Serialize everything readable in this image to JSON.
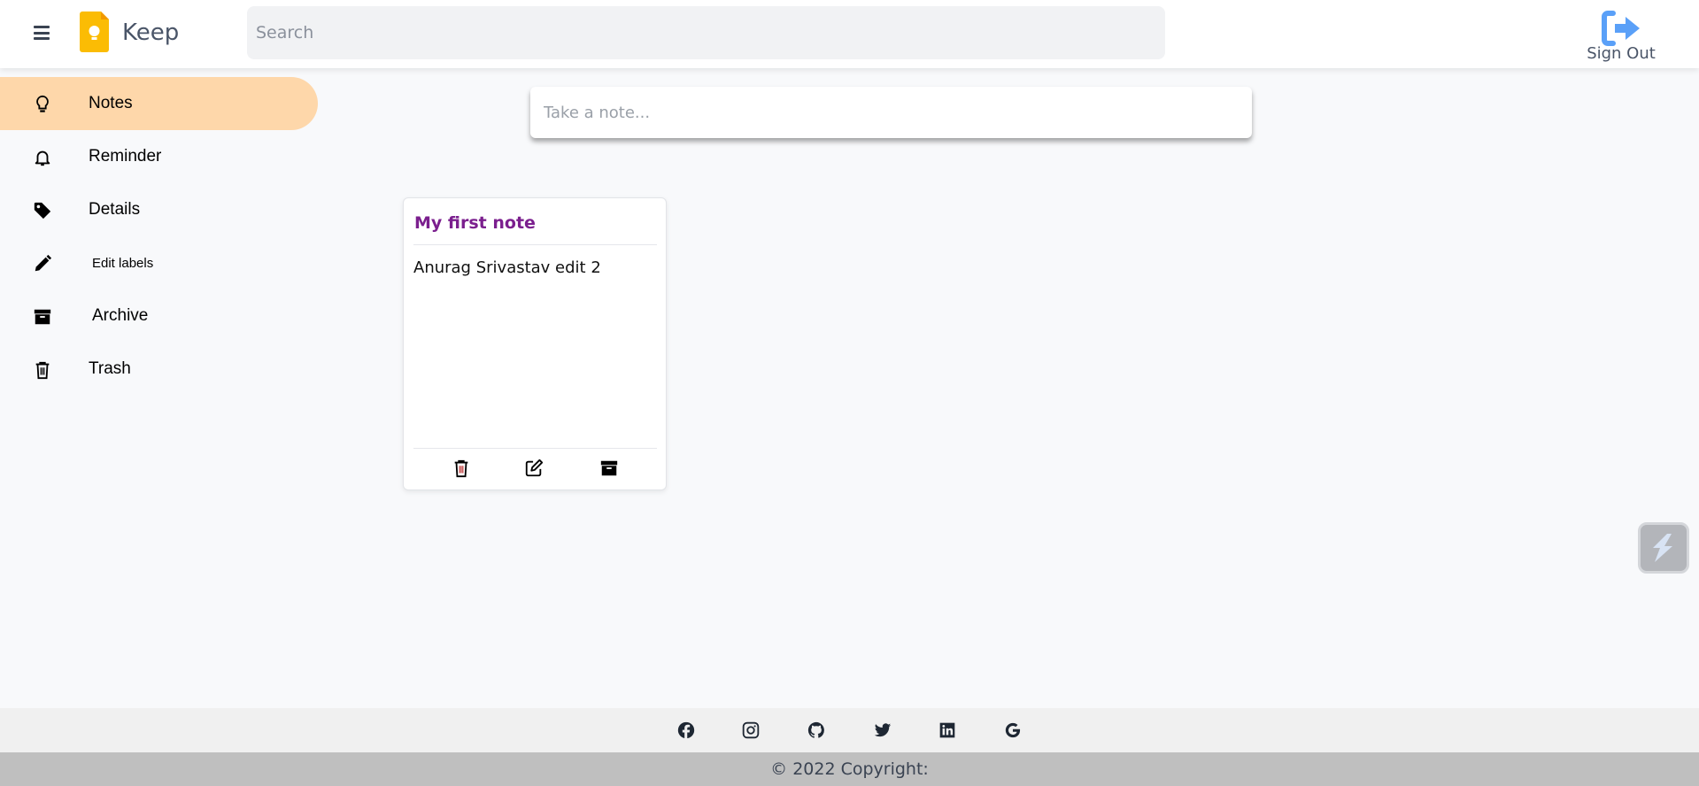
{
  "header": {
    "brand": "Keep",
    "search_placeholder": "Search",
    "sign_out": "Sign Out"
  },
  "sidebar": {
    "items": [
      {
        "label": "Notes",
        "icon": "lightbulb-icon",
        "active": true
      },
      {
        "label": "Reminder",
        "icon": "bell-icon"
      },
      {
        "label": "Details",
        "icon": "tag-icon"
      },
      {
        "label": "Edit labels",
        "icon": "pencil-icon"
      },
      {
        "label": "Archive",
        "icon": "archive-icon"
      },
      {
        "label": "Trash",
        "icon": "trash-icon"
      }
    ]
  },
  "main": {
    "take_note_placeholder": "Take a note...",
    "notes": [
      {
        "title": "My first note",
        "body": "Anurag Srivastav edit 2"
      }
    ]
  },
  "footer": {
    "social": [
      "facebook-icon",
      "instagram-icon",
      "github-icon",
      "twitter-icon",
      "linkedin-icon",
      "google-icon"
    ],
    "copyright": "© 2022 Copyright:"
  },
  "colors": {
    "active": "#fed7aa",
    "title": "#7b1f8e",
    "signout": "#5aa0f8"
  }
}
